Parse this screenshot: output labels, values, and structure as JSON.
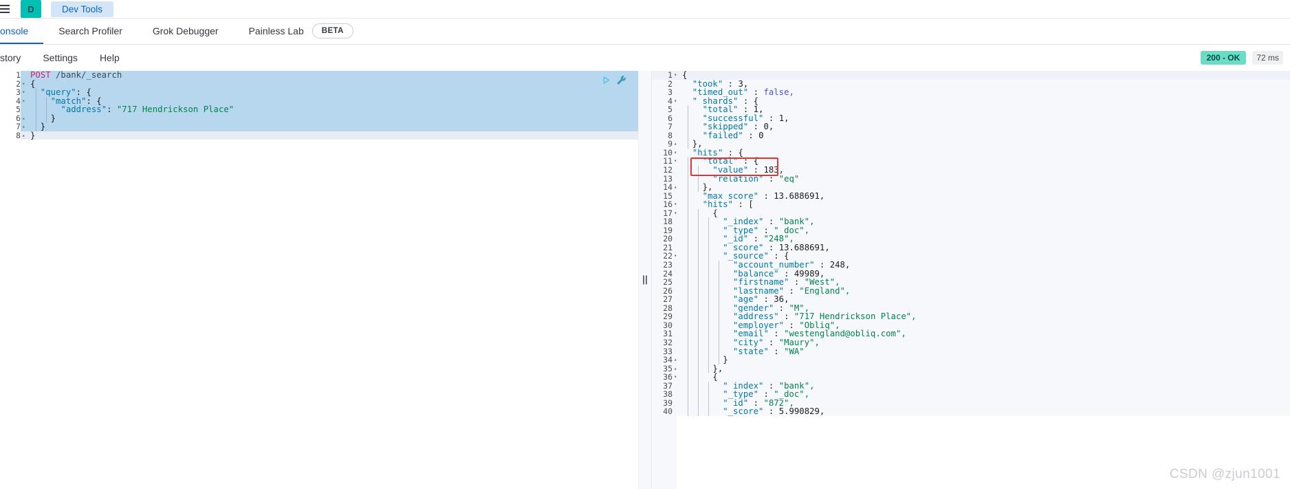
{
  "topbar": {
    "menu_icon": "hamburger-menu-icon",
    "logo_letter": "D",
    "app_chip_label": "Dev Tools"
  },
  "tabs": [
    {
      "label": "onsole",
      "active": true,
      "beta": false
    },
    {
      "label": "Search Profiler",
      "active": false,
      "beta": false
    },
    {
      "label": "Grok Debugger",
      "active": false,
      "beta": false
    },
    {
      "label": "Painless Lab",
      "active": false,
      "beta": true,
      "beta_label": "BETA"
    }
  ],
  "submenu": [
    {
      "label": "story"
    },
    {
      "label": "Settings"
    },
    {
      "label": "Help"
    }
  ],
  "status": {
    "code_label": "200 - OK",
    "time_label": "72 ms",
    "ok_color": "#6ddcc4",
    "time_color": "#eef0f4"
  },
  "editor": {
    "actions": [
      {
        "name": "run-request-icon",
        "title": "click to send request"
      },
      {
        "name": "wrench-icon",
        "title": "open documentation"
      }
    ],
    "lines": [
      {
        "n": 1,
        "fold": "",
        "selected": true,
        "cursor": false,
        "tokens": [
          {
            "c": "t-method",
            "t": "POST"
          },
          {
            "c": "t-url",
            "t": " /bank/_search"
          }
        ]
      },
      {
        "n": 2,
        "fold": "▾",
        "selected": true,
        "cursor": false,
        "tokens": [
          {
            "c": "t-punc",
            "t": "{"
          }
        ]
      },
      {
        "n": 3,
        "fold": "▾",
        "selected": true,
        "cursor": false,
        "tokens": [
          {
            "c": "t-key",
            "t": "  \"query\""
          },
          {
            "c": "t-punc",
            "t": ": {"
          }
        ]
      },
      {
        "n": 4,
        "fold": "▾",
        "selected": true,
        "cursor": false,
        "tokens": [
          {
            "c": "t-key",
            "t": "    \"match\""
          },
          {
            "c": "t-punc",
            "t": ": {"
          }
        ]
      },
      {
        "n": 5,
        "fold": "",
        "selected": true,
        "cursor": false,
        "tokens": [
          {
            "c": "t-key",
            "t": "      \"address\""
          },
          {
            "c": "t-punc",
            "t": ": "
          },
          {
            "c": "t-str",
            "t": "\"717 Hendrickson Place\""
          }
        ]
      },
      {
        "n": 6,
        "fold": "▴",
        "selected": true,
        "cursor": false,
        "tokens": [
          {
            "c": "t-punc",
            "t": "    }"
          }
        ]
      },
      {
        "n": 7,
        "fold": "▴",
        "selected": true,
        "cursor": false,
        "tokens": [
          {
            "c": "t-punc",
            "t": "  }"
          }
        ]
      },
      {
        "n": 8,
        "fold": "▴",
        "selected": false,
        "cursor": true,
        "tokens": [
          {
            "c": "t-punc",
            "t": "}"
          }
        ]
      }
    ]
  },
  "response": {
    "lines": [
      {
        "n": 1,
        "fold": "▾",
        "tokens": [
          {
            "c": "t-punc",
            "t": "{"
          }
        ]
      },
      {
        "n": 2,
        "fold": "",
        "tokens": [
          {
            "c": "t-key",
            "t": "  \"took\""
          },
          {
            "c": "t-punc",
            "t": " : "
          },
          {
            "c": "t-num",
            "t": "3,"
          }
        ]
      },
      {
        "n": 3,
        "fold": "",
        "tokens": [
          {
            "c": "t-key",
            "t": "  \"timed_out\""
          },
          {
            "c": "t-punc",
            "t": " : "
          },
          {
            "c": "t-bool",
            "t": "false,"
          }
        ]
      },
      {
        "n": 4,
        "fold": "▾",
        "tokens": [
          {
            "c": "t-key",
            "t": "  \"_shards\""
          },
          {
            "c": "t-punc",
            "t": " : {"
          }
        ]
      },
      {
        "n": 5,
        "fold": "",
        "tokens": [
          {
            "c": "t-key",
            "t": "    \"total\""
          },
          {
            "c": "t-punc",
            "t": " : "
          },
          {
            "c": "t-num",
            "t": "1,"
          }
        ]
      },
      {
        "n": 6,
        "fold": "",
        "tokens": [
          {
            "c": "t-key",
            "t": "    \"successful\""
          },
          {
            "c": "t-punc",
            "t": " : "
          },
          {
            "c": "t-num",
            "t": "1,"
          }
        ]
      },
      {
        "n": 7,
        "fold": "",
        "tokens": [
          {
            "c": "t-key",
            "t": "    \"skipped\""
          },
          {
            "c": "t-punc",
            "t": " : "
          },
          {
            "c": "t-num",
            "t": "0,"
          }
        ]
      },
      {
        "n": 8,
        "fold": "",
        "tokens": [
          {
            "c": "t-key",
            "t": "    \"failed\""
          },
          {
            "c": "t-punc",
            "t": " : "
          },
          {
            "c": "t-num",
            "t": "0"
          }
        ]
      },
      {
        "n": 9,
        "fold": "▴",
        "tokens": [
          {
            "c": "t-punc",
            "t": "  },"
          }
        ]
      },
      {
        "n": 10,
        "fold": "▾",
        "tokens": [
          {
            "c": "t-key",
            "t": "  \"hits\""
          },
          {
            "c": "t-punc",
            "t": " : {"
          }
        ]
      },
      {
        "n": 11,
        "fold": "▾",
        "tokens": [
          {
            "c": "t-key",
            "t": "    \"total\""
          },
          {
            "c": "t-punc",
            "t": " : {"
          }
        ]
      },
      {
        "n": 12,
        "fold": "",
        "tokens": [
          {
            "c": "t-key",
            "t": "      \"value\""
          },
          {
            "c": "t-punc",
            "t": " : "
          },
          {
            "c": "t-num",
            "t": "183,"
          }
        ]
      },
      {
        "n": 13,
        "fold": "",
        "tokens": [
          {
            "c": "t-key",
            "t": "      \"relation\""
          },
          {
            "c": "t-punc",
            "t": " : "
          },
          {
            "c": "t-str",
            "t": "\"eq\""
          }
        ]
      },
      {
        "n": 14,
        "fold": "▴",
        "tokens": [
          {
            "c": "t-punc",
            "t": "    },"
          }
        ]
      },
      {
        "n": 15,
        "fold": "",
        "tokens": [
          {
            "c": "t-key",
            "t": "    \"max_score\""
          },
          {
            "c": "t-punc",
            "t": " : "
          },
          {
            "c": "t-num",
            "t": "13.688691,"
          }
        ]
      },
      {
        "n": 16,
        "fold": "▾",
        "tokens": [
          {
            "c": "t-key",
            "t": "    \"hits\""
          },
          {
            "c": "t-punc",
            "t": " : ["
          }
        ]
      },
      {
        "n": 17,
        "fold": "▾",
        "tokens": [
          {
            "c": "t-punc",
            "t": "      {"
          }
        ]
      },
      {
        "n": 18,
        "fold": "",
        "tokens": [
          {
            "c": "t-key",
            "t": "        \"_index\""
          },
          {
            "c": "t-punc",
            "t": " : "
          },
          {
            "c": "t-str",
            "t": "\"bank\","
          }
        ]
      },
      {
        "n": 19,
        "fold": "",
        "tokens": [
          {
            "c": "t-key",
            "t": "        \"_type\""
          },
          {
            "c": "t-punc",
            "t": " : "
          },
          {
            "c": "t-str",
            "t": "\"_doc\","
          }
        ]
      },
      {
        "n": 20,
        "fold": "",
        "tokens": [
          {
            "c": "t-key",
            "t": "        \"_id\""
          },
          {
            "c": "t-punc",
            "t": " : "
          },
          {
            "c": "t-str",
            "t": "\"248\","
          }
        ]
      },
      {
        "n": 21,
        "fold": "",
        "tokens": [
          {
            "c": "t-key",
            "t": "        \"_score\""
          },
          {
            "c": "t-punc",
            "t": " : "
          },
          {
            "c": "t-num",
            "t": "13.688691,"
          }
        ]
      },
      {
        "n": 22,
        "fold": "▾",
        "tokens": [
          {
            "c": "t-key",
            "t": "        \"_source\""
          },
          {
            "c": "t-punc",
            "t": " : {"
          }
        ]
      },
      {
        "n": 23,
        "fold": "",
        "tokens": [
          {
            "c": "t-key",
            "t": "          \"account_number\""
          },
          {
            "c": "t-punc",
            "t": " : "
          },
          {
            "c": "t-num",
            "t": "248,"
          }
        ]
      },
      {
        "n": 24,
        "fold": "",
        "tokens": [
          {
            "c": "t-key",
            "t": "          \"balance\""
          },
          {
            "c": "t-punc",
            "t": " : "
          },
          {
            "c": "t-num",
            "t": "49989,"
          }
        ]
      },
      {
        "n": 25,
        "fold": "",
        "tokens": [
          {
            "c": "t-key",
            "t": "          \"firstname\""
          },
          {
            "c": "t-punc",
            "t": " : "
          },
          {
            "c": "t-str",
            "t": "\"West\","
          }
        ]
      },
      {
        "n": 26,
        "fold": "",
        "tokens": [
          {
            "c": "t-key",
            "t": "          \"lastname\""
          },
          {
            "c": "t-punc",
            "t": " : "
          },
          {
            "c": "t-str",
            "t": "\"England\","
          }
        ]
      },
      {
        "n": 27,
        "fold": "",
        "tokens": [
          {
            "c": "t-key",
            "t": "          \"age\""
          },
          {
            "c": "t-punc",
            "t": " : "
          },
          {
            "c": "t-num",
            "t": "36,"
          }
        ]
      },
      {
        "n": 28,
        "fold": "",
        "tokens": [
          {
            "c": "t-key",
            "t": "          \"gender\""
          },
          {
            "c": "t-punc",
            "t": " : "
          },
          {
            "c": "t-str",
            "t": "\"M\","
          }
        ]
      },
      {
        "n": 29,
        "fold": "",
        "tokens": [
          {
            "c": "t-key",
            "t": "          \"address\""
          },
          {
            "c": "t-punc",
            "t": " : "
          },
          {
            "c": "t-str",
            "t": "\"717 Hendrickson Place\","
          }
        ]
      },
      {
        "n": 30,
        "fold": "",
        "tokens": [
          {
            "c": "t-key",
            "t": "          \"employer\""
          },
          {
            "c": "t-punc",
            "t": " : "
          },
          {
            "c": "t-str",
            "t": "\"Obliq\","
          }
        ]
      },
      {
        "n": 31,
        "fold": "",
        "tokens": [
          {
            "c": "t-key",
            "t": "          \"email\""
          },
          {
            "c": "t-punc",
            "t": " : "
          },
          {
            "c": "t-str",
            "t": "\"westengland@obliq.com\","
          }
        ]
      },
      {
        "n": 32,
        "fold": "",
        "tokens": [
          {
            "c": "t-key",
            "t": "          \"city\""
          },
          {
            "c": "t-punc",
            "t": " : "
          },
          {
            "c": "t-str",
            "t": "\"Maury\","
          }
        ]
      },
      {
        "n": 33,
        "fold": "",
        "tokens": [
          {
            "c": "t-key",
            "t": "          \"state\""
          },
          {
            "c": "t-punc",
            "t": " : "
          },
          {
            "c": "t-str",
            "t": "\"WA\""
          }
        ]
      },
      {
        "n": 34,
        "fold": "▴",
        "tokens": [
          {
            "c": "t-punc",
            "t": "        }"
          }
        ]
      },
      {
        "n": 35,
        "fold": "▴",
        "tokens": [
          {
            "c": "t-punc",
            "t": "      },"
          }
        ]
      },
      {
        "n": 36,
        "fold": "▾",
        "tokens": [
          {
            "c": "t-punc",
            "t": "      {"
          }
        ]
      },
      {
        "n": 37,
        "fold": "",
        "tokens": [
          {
            "c": "t-key",
            "t": "        \"_index\""
          },
          {
            "c": "t-punc",
            "t": " : "
          },
          {
            "c": "t-str",
            "t": "\"bank\","
          }
        ]
      },
      {
        "n": 38,
        "fold": "",
        "tokens": [
          {
            "c": "t-key",
            "t": "        \"_type\""
          },
          {
            "c": "t-punc",
            "t": " : "
          },
          {
            "c": "t-str",
            "t": "\"_doc\","
          }
        ]
      },
      {
        "n": 39,
        "fold": "",
        "tokens": [
          {
            "c": "t-key",
            "t": "        \"_id\""
          },
          {
            "c": "t-punc",
            "t": " : "
          },
          {
            "c": "t-str",
            "t": "\"872\","
          }
        ]
      },
      {
        "n": 40,
        "fold": "",
        "tokens": [
          {
            "c": "t-key",
            "t": "        \"_score\""
          },
          {
            "c": "t-punc",
            "t": " : "
          },
          {
            "c": "t-num",
            "t": "5.990829,"
          }
        ]
      }
    ]
  },
  "annotation": {
    "color": "#e8322b",
    "highlights_lines": [
      11,
      12
    ]
  },
  "watermark": {
    "text": "CSDN @zjun1001"
  }
}
